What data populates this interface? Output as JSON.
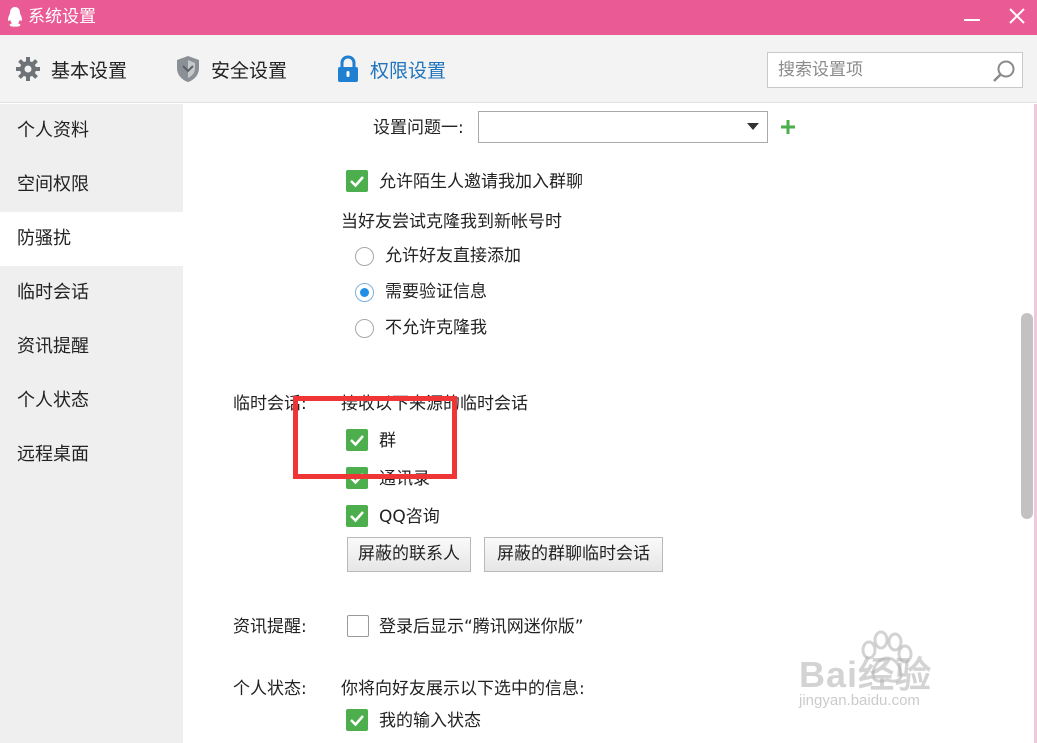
{
  "window": {
    "title": "系统设置",
    "icons": {
      "app": "qq-penguin-icon",
      "minimize": "minimize-icon",
      "close": "close-icon"
    },
    "colors": {
      "titlebar": "#ea5b96",
      "accent": "#1f74bd",
      "checkbox": "#4cae4c",
      "highlight": "#ef3535"
    }
  },
  "topnav": {
    "tabs": [
      {
        "label": "基本设置",
        "icon": "gear-icon"
      },
      {
        "label": "安全设置",
        "icon": "shield-icon"
      },
      {
        "label": "权限设置",
        "icon": "lock-icon",
        "active": true
      }
    ],
    "search": {
      "placeholder": "搜索设置项",
      "value": "",
      "icon": "search-icon"
    }
  },
  "sidebar": {
    "items": [
      {
        "label": "个人资料"
      },
      {
        "label": "空间权限"
      },
      {
        "label": "防骚扰",
        "active": true
      },
      {
        "label": "临时会话"
      },
      {
        "label": "资讯提醒"
      },
      {
        "label": "个人状态"
      },
      {
        "label": "远程桌面"
      }
    ]
  },
  "content": {
    "question": {
      "label": "设置问题一:",
      "value": "",
      "add_icon": "plus-icon"
    },
    "allow_stranger_group_invite": {
      "label": "允许陌生人邀请我加入群聊",
      "checked": true
    },
    "clone": {
      "heading": "当好友尝试克隆我到新帐号时",
      "options": [
        {
          "label": "允许好友直接添加",
          "selected": false
        },
        {
          "label": "需要验证信息",
          "selected": true
        },
        {
          "label": "不允许克隆我",
          "selected": false
        }
      ]
    },
    "temp_session": {
      "section_label": "临时会话:",
      "description": "接收以下来源的临时会话",
      "options": [
        {
          "label": "群",
          "checked": true
        },
        {
          "label": "通讯录",
          "checked": true
        },
        {
          "label": "QQ咨询",
          "checked": true
        }
      ],
      "buttons": {
        "blocked_contacts": "屏蔽的联系人",
        "blocked_group_sessions": "屏蔽的群聊临时会话"
      }
    },
    "news": {
      "section_label": "资讯提醒:",
      "option": {
        "label": "登录后显示“腾讯网迷你版”",
        "checked": false
      }
    },
    "status": {
      "section_label": "个人状态:",
      "description": "你将向好友展示以下选中的信息:",
      "option": {
        "label": "我的输入状态",
        "checked": true
      }
    }
  },
  "watermark": {
    "main": "Bai经验",
    "sub": "jingyan.baidu.com"
  }
}
